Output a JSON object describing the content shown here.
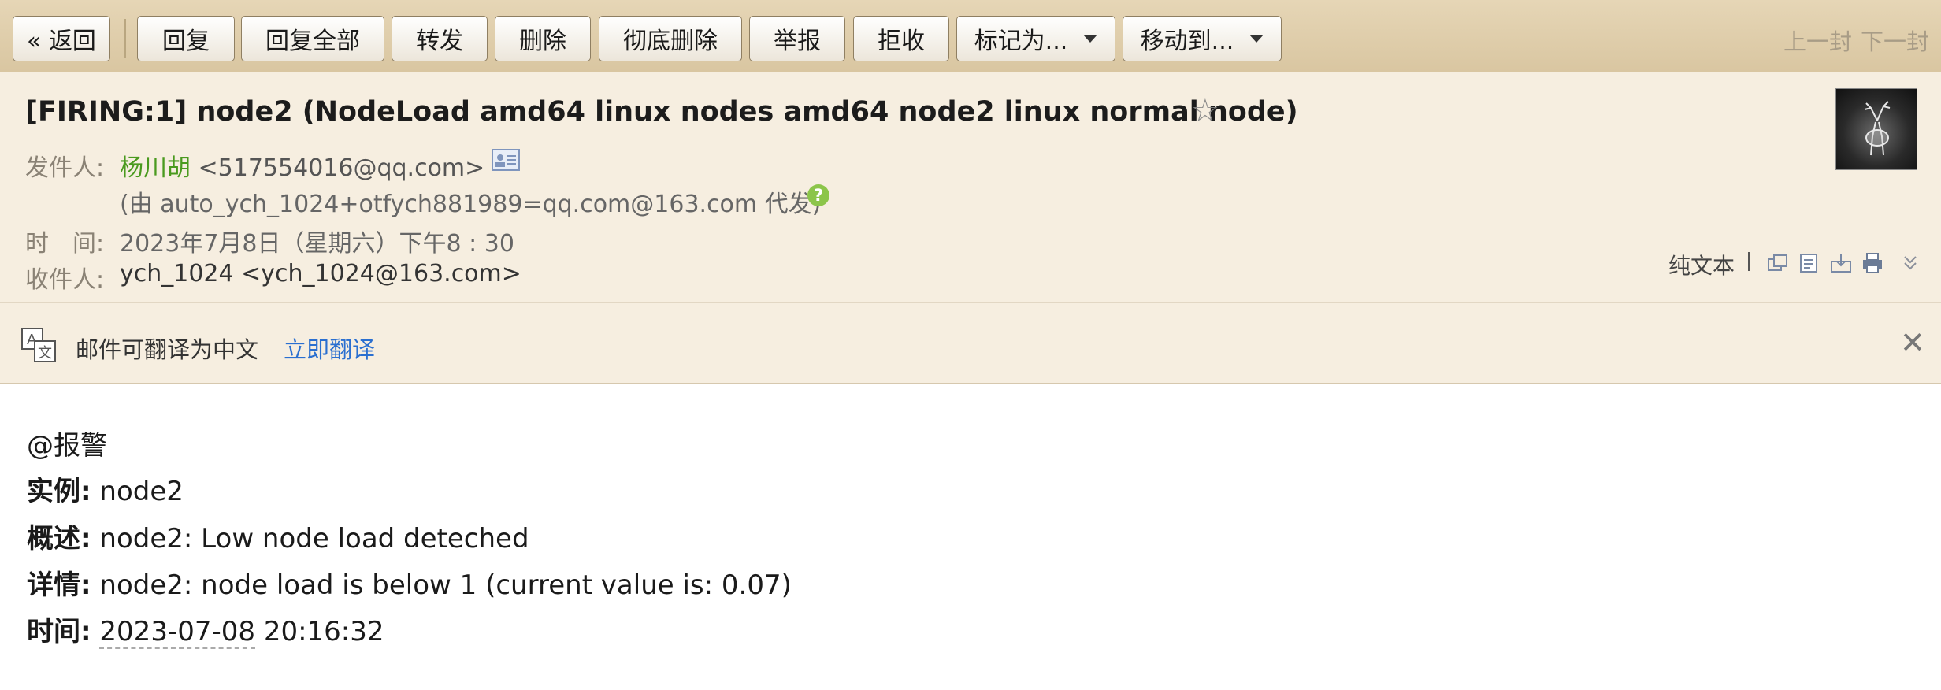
{
  "toolbar": {
    "back": "« 返回",
    "reply": "回复",
    "reply_all": "回复全部",
    "forward": "转发",
    "delete": "删除",
    "delete_permanently": "彻底删除",
    "report": "举报",
    "reject": "拒收",
    "mark_as": "标记为...",
    "move_to": "移动到...",
    "prev": "上一封",
    "next": "下一封"
  },
  "header": {
    "subject": "[FIRING:1] node2 (NodeLoad amd64 linux nodes amd64 node2 linux normal node)",
    "from_label": "发件人:",
    "from_name": "杨川胡",
    "from_addr": "<517554016@qq.com>",
    "proxy_note": "(由 auto_ych_1024+otfych881989=qq.com@163.com 代发)",
    "time_label": "时　间:",
    "time_value": "2023年7月8日（星期六）下午8 : 30",
    "to_label": "收件人:",
    "to_value": "ych_1024 <ych_1024@163.com>",
    "plain_text": "纯文本",
    "help_glyph": "?"
  },
  "translate": {
    "text": "邮件可翻译为中文",
    "link": "立即翻译"
  },
  "body": {
    "mention": "@报警",
    "instance_label": "实例:",
    "instance_value": "node2",
    "summary_label": "概述:",
    "summary_value": "node2: Low node load deteched",
    "detail_label": "详情:",
    "detail_value": "node2: node load is below 1 (current value is: 0.07)",
    "time_label": "时间:",
    "time_date": "2023-07-08",
    "time_clock": "20:16:32"
  },
  "icons": {
    "star": "star-outline-icon",
    "contact_card": "contact-card-icon",
    "help": "question-icon",
    "translate": "translate-icon",
    "close": "close-icon",
    "new_window": "new-window-icon",
    "memo": "memo-icon",
    "download": "download-icon",
    "print": "print-icon",
    "expand": "double-chevron-down-icon"
  },
  "colors": {
    "toolbar_bg": "#ddcba8",
    "header_bg": "#f6eee0",
    "sender_name": "#4a9a1f",
    "link": "#2a6fd0"
  }
}
